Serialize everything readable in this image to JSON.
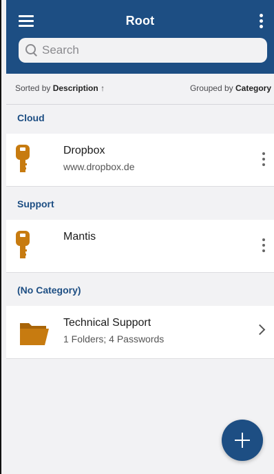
{
  "colors": {
    "header": "#1d4e83",
    "key": "#c77b10",
    "folder": "#c77b10"
  },
  "header": {
    "title": "Root",
    "menu_icon": "hamburger-icon",
    "more_icon": "more-vertical-icon"
  },
  "search": {
    "placeholder": "Search",
    "icon": "search-icon"
  },
  "sort": {
    "prefix": "Sorted by ",
    "field": "Description",
    "arrow": "↑",
    "group_prefix": "Grouped by ",
    "group_field": "Category"
  },
  "sections": [
    {
      "title": "Cloud",
      "items": [
        {
          "name": "Dropbox",
          "sub": "www.dropbox.de",
          "icon": "key-icon",
          "action": "more-icon"
        }
      ]
    },
    {
      "title": "Support",
      "items": [
        {
          "name": "Mantis",
          "sub": "",
          "icon": "key-icon",
          "action": "more-icon"
        }
      ]
    },
    {
      "title": "(No Category)",
      "items": [
        {
          "name": "Technical Support",
          "sub": "1 Folders; 4 Passwords",
          "icon": "folder-icon",
          "action": "chevron-right-icon"
        }
      ]
    }
  ],
  "fab": {
    "icon": "plus-icon"
  }
}
